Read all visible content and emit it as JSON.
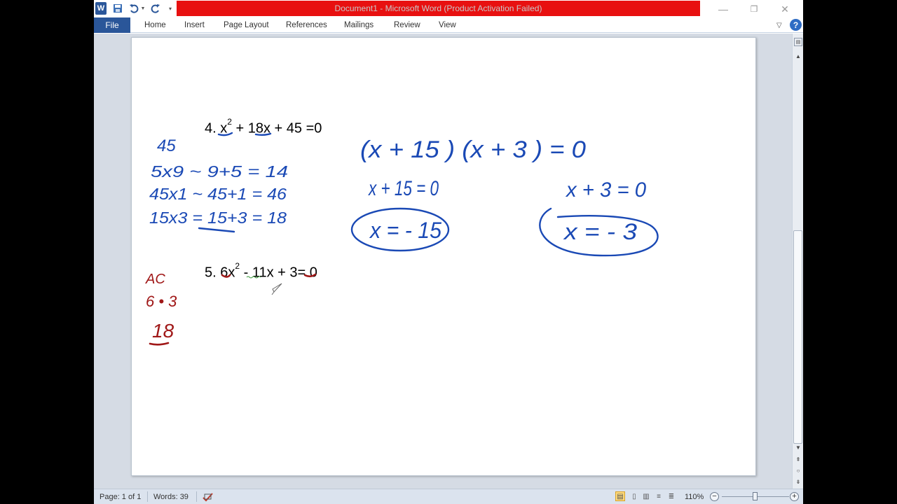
{
  "app": {
    "title": "Document1 - Microsoft Word (Product Activation Failed)",
    "word_icon": "W"
  },
  "qat": {
    "save_icon": "save-icon",
    "undo_icon": "undo-icon",
    "redo_icon": "redo-icon",
    "customize_icon": "customize-qat-icon"
  },
  "window": {
    "minimize": "—",
    "restore": "❐",
    "close": "✕"
  },
  "ribbon": {
    "file": "File",
    "tabs": [
      "Home",
      "Insert",
      "Page Layout",
      "References",
      "Mailings",
      "Review",
      "View"
    ],
    "help": "?"
  },
  "document": {
    "problem4": {
      "num": "4. ",
      "a": "x",
      "exp": "2",
      "rest": " + 18x + 45 =0"
    },
    "problem5": {
      "num": "5. ",
      "a": "6x",
      "exp": "2",
      "rest": " - 11x + 3= 0"
    },
    "ink": {
      "product_marker": "45",
      "factor_rows": [
        "5x9 ~ 9+5  =  14",
        "45x1 ~ 45+1  =  46",
        "15x3 = 15+3 = 18"
      ],
      "factored": "(x + 15 ) (x + 3 ) = 0",
      "eq_left": "x + 15 = 0",
      "eq_right": "x + 3 = 0",
      "solution_left": "x = - 15",
      "solution_right": "x = - 3",
      "ac_label": "AC",
      "ac_product": "6 • 3",
      "ac_value": "18"
    }
  },
  "status": {
    "page": "Page: 1 of 1",
    "words": "Words: 39",
    "zoom": "110%",
    "zoom_level_percent": 110
  },
  "colors": {
    "ink_blue": "#1a49b5",
    "ink_red": "#a01818",
    "title_red": "#e81010",
    "file_blue": "#2a5699"
  }
}
